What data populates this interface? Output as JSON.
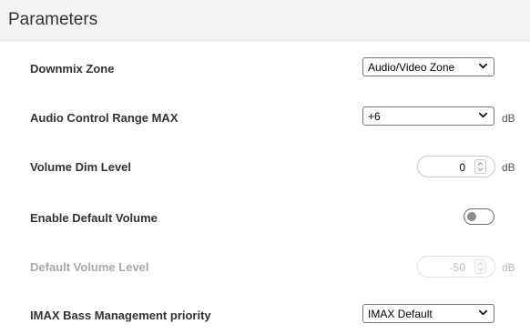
{
  "panel": {
    "title": "Parameters"
  },
  "rows": [
    {
      "label": "Downmix Zone",
      "control": "select",
      "value": "Audio/Video Zone",
      "unit": "",
      "enabled": true
    },
    {
      "label": "Audio Control Range MAX",
      "control": "select",
      "value": "+6",
      "unit": "dB",
      "enabled": true
    },
    {
      "label": "Volume Dim Level",
      "control": "stepper",
      "value": "0",
      "unit": "dB",
      "enabled": true
    },
    {
      "label": "Enable Default Volume",
      "control": "toggle",
      "checked": false,
      "enabled": true
    },
    {
      "label": "Default Volume Level",
      "control": "stepper",
      "value": "-50",
      "unit": "dB",
      "enabled": false
    },
    {
      "label": "IMAX Bass Management priority",
      "control": "select",
      "value": "IMAX Default",
      "unit": "",
      "enabled": true
    }
  ],
  "icons": {
    "select_arrow": "chevron-down-icon",
    "spin_arrows": "spin-updown-icon"
  },
  "colors": {
    "text": "#333333",
    "disabled_text": "#a8a8a8",
    "header_bg": "#f3f3f3",
    "toggle_knob_off": "#8a8a8a"
  }
}
